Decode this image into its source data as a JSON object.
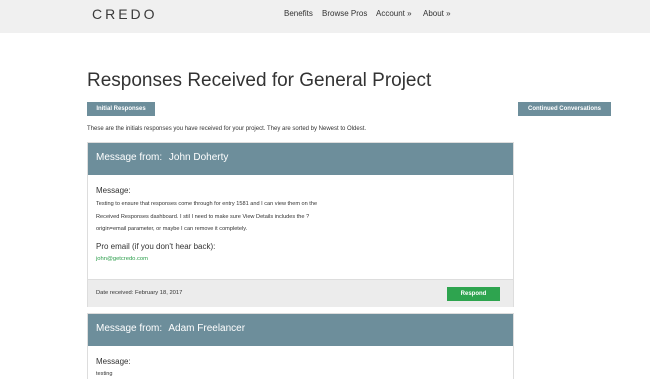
{
  "header": {
    "logo": "CREDO",
    "nav": {
      "benefits": "Benefits",
      "browse_pros": "Browse Pros",
      "account": "Account »",
      "about": "About »"
    }
  },
  "main": {
    "title": "Responses Received for General Project",
    "tabs": {
      "initial": "Initial Responses",
      "continued": "Continued Conversations"
    },
    "intro": "These are the initials responses you have received for your project. They are sorted by Newest to Oldest.",
    "messages": [
      {
        "from_label": "Message from:",
        "from_name": "John Doherty",
        "message_label": "Message:",
        "message_lines": [
          "Testing to ensure that responses come through for entry 1581 and I can view them on the",
          "Received Responses dashboard. I stil I need to make sure View Details includes the ?",
          "origin=email parameter, or maybe I can remove it completely."
        ],
        "email_label": "Pro email (if you don't hear back):",
        "email": "john@getcredo.com",
        "date_text": "Date received:  February 18, 2017",
        "respond_label": "Respond"
      },
      {
        "from_label": "Message from:",
        "from_name": "Adam Freelancer",
        "message_label": "Message:",
        "message_lines": [
          "testing"
        ]
      }
    ]
  },
  "colors": {
    "accent": "#6d8e9b",
    "respond": "#2ea44f",
    "link": "#2a9d4a",
    "topbar": "#f0f0f0"
  }
}
